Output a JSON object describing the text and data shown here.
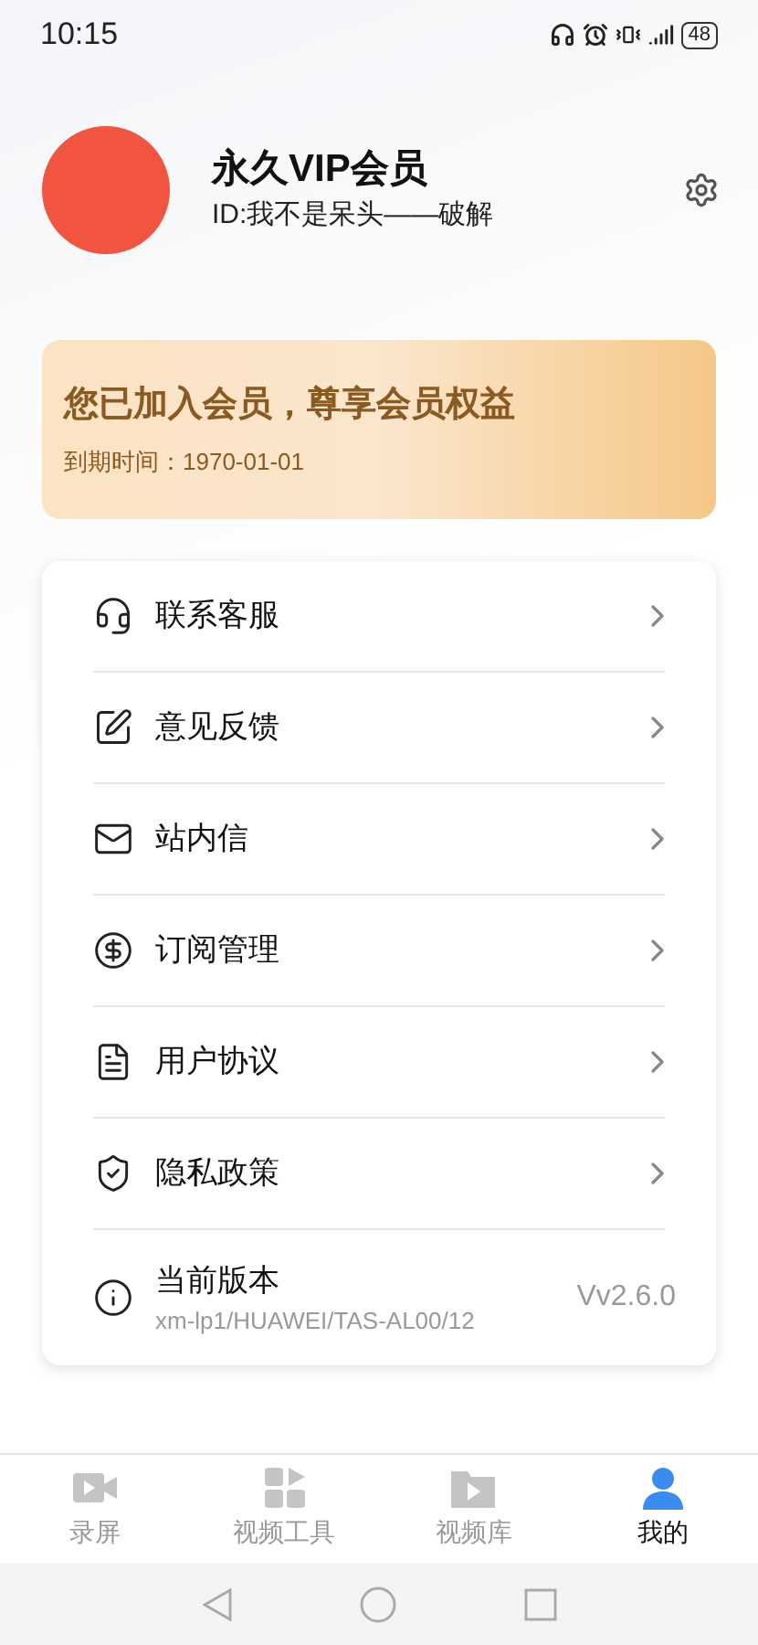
{
  "status_bar": {
    "time": "10:15",
    "battery": "48"
  },
  "profile": {
    "name": "永久VIP会员",
    "id": "ID:我不是呆头——破解"
  },
  "membership": {
    "title": "您已加入会员，尊享会员权益",
    "expiry": "到期时间：1970-01-01"
  },
  "menu": [
    {
      "kind": "link",
      "label": "联系客服"
    },
    {
      "kind": "link",
      "label": "意见反馈"
    },
    {
      "kind": "link",
      "label": "站内信"
    },
    {
      "kind": "link",
      "label": "订阅管理"
    },
    {
      "kind": "link",
      "label": "用户协议"
    },
    {
      "kind": "link",
      "label": "隐私政策"
    },
    {
      "kind": "version",
      "label": "当前版本",
      "detail": "xm-lp1/HUAWEI/TAS-AL00/12",
      "value": "Vv2.6.0"
    }
  ],
  "tabs": [
    {
      "label": "录屏",
      "selected": false
    },
    {
      "label": "视频工具",
      "selected": false
    },
    {
      "label": "视频库",
      "selected": false
    },
    {
      "label": "我的",
      "selected": true
    }
  ]
}
